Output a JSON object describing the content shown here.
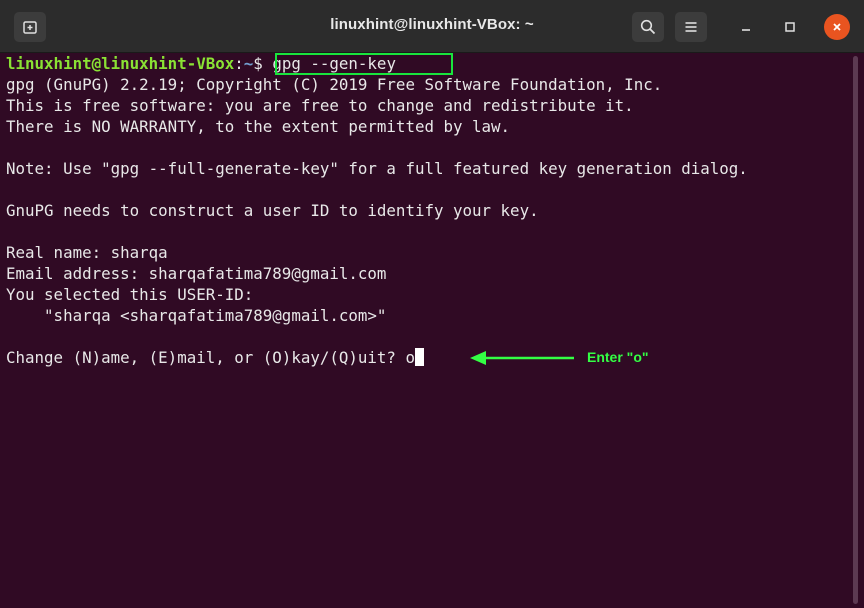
{
  "window": {
    "title": "linuxhint@linuxhint-VBox: ~"
  },
  "titlebar": {
    "icons": [
      "new-tab-icon",
      "search-icon",
      "hamburger-menu-icon",
      "minimize-icon",
      "maximize-icon",
      "close-icon"
    ]
  },
  "terminal": {
    "prompt": {
      "user_host": "linuxhint@linuxhint-VBox",
      "separator": ":",
      "path": "~",
      "command": "$ gpg --gen-key"
    },
    "lines": [
      "gpg (GnuPG) 2.2.19; Copyright (C) 2019 Free Software Foundation, Inc.",
      "This is free software: you are free to change and redistribute it.",
      "There is NO WARRANTY, to the extent permitted by law.",
      "",
      "Note: Use \"gpg --full-generate-key\" for a full featured key generation dialog.",
      "",
      "GnuPG needs to construct a user ID to identify your key.",
      "",
      "Real name: sharqa",
      "Email address: sharqafatima789@gmail.com",
      "You selected this USER-ID:",
      "    \"sharqa <sharqafatima789@gmail.com>\"",
      ""
    ],
    "input_line": {
      "prompt_text": "Change (N)ame, (E)mail, or (O)kay/(Q)uit? ",
      "typed": "o"
    }
  },
  "annotation": {
    "text": "Enter \"o\"",
    "color": "#33ff44",
    "highlight_color": "#19e43d"
  },
  "colors": {
    "terminal_bg": "#300a24",
    "titlebar_bg": "#2c2c2c",
    "prompt_user": "#8ae234",
    "prompt_path": "#729fcf",
    "close_button": "#e95420"
  }
}
